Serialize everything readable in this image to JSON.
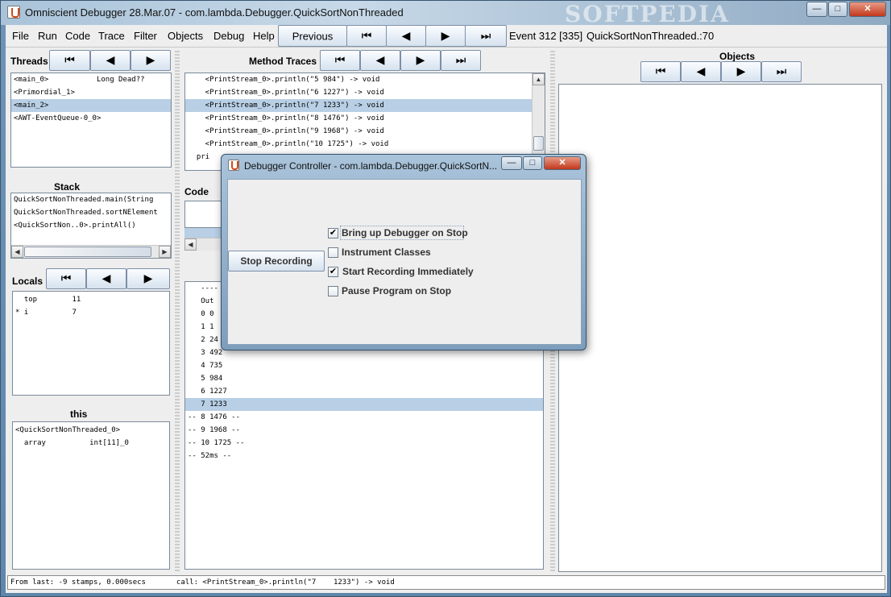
{
  "window": {
    "title": "Omniscient Debugger 28.Mar.07 - com.lambda.Debugger.QuickSortNonThreaded",
    "watermark": "SOFTPEDIA",
    "minimize": "—",
    "maximize": "□",
    "close": "✕"
  },
  "menubar": {
    "items": [
      "File",
      "Run",
      "Code",
      "Trace",
      "Filter",
      "Objects",
      "Debug",
      "Help"
    ],
    "previous_label": "Previous",
    "event_label": "Event 312 [335]",
    "location_label": "QuickSortNonThreaded.:70"
  },
  "nav_glyphs": {
    "first": "⏮",
    "prev": "◀",
    "next": "▶",
    "last": "⏭"
  },
  "threads": {
    "title": "Threads",
    "rows": [
      {
        "text": "<main_0>           Long Dead??",
        "selected": false
      },
      {
        "text": "<Primordial_1>",
        "selected": false
      },
      {
        "text": "<main_2>",
        "selected": true
      },
      {
        "text": "<AWT-EventQueue-0_0>",
        "selected": false
      }
    ]
  },
  "stack": {
    "title": "Stack",
    "rows": [
      "QuickSortNonThreaded.main(String",
      "QuickSortNonThreaded.sortNElement",
      "<QuickSortNon..0>.printAll()"
    ]
  },
  "locals": {
    "title": "Locals",
    "rows": [
      "  top        11",
      "* i          7"
    ]
  },
  "this_panel": {
    "title": "this",
    "rows": [
      "<QuickSortNonThreaded_0>",
      "  array          int[11]_0"
    ]
  },
  "method_traces": {
    "title": "Method Traces",
    "rows": [
      {
        "text": "    <PrintStream_0>.println(\"5 984\") -> void",
        "selected": false
      },
      {
        "text": "    <PrintStream_0>.println(\"6 1227\") -> void",
        "selected": false
      },
      {
        "text": "    <PrintStream_0>.println(\"7 1233\") -> void",
        "selected": true
      },
      {
        "text": "    <PrintStream_0>.println(\"8 1476\") -> void",
        "selected": false
      },
      {
        "text": "    <PrintStream_0>.println(\"9 1968\") -> void",
        "selected": false
      },
      {
        "text": "    <PrintStream_0>.println(\"10 1725\") -> void",
        "selected": false
      },
      {
        "text": "  pri",
        "selected": false
      }
    ]
  },
  "code": {
    "title": "Code"
  },
  "output": {
    "rows": [
      {
        "text": "   ----",
        "selected": false
      },
      {
        "text": "   Out",
        "selected": false
      },
      {
        "text": "   0 0",
        "selected": false
      },
      {
        "text": "   1 1",
        "selected": false
      },
      {
        "text": "   2 24",
        "selected": false
      },
      {
        "text": "   3 492",
        "selected": false
      },
      {
        "text": "   4 735",
        "selected": false
      },
      {
        "text": "   5 984",
        "selected": false
      },
      {
        "text": "   6 1227",
        "selected": false
      },
      {
        "text": "   7 1233",
        "selected": true
      },
      {
        "text": "-- 8 1476 --",
        "selected": false
      },
      {
        "text": "-- 9 1968 --",
        "selected": false
      },
      {
        "text": "-- 10 1725 --",
        "selected": false
      },
      {
        "text": "-- 52ms --",
        "selected": false
      }
    ]
  },
  "objects": {
    "title": "Objects"
  },
  "dialog": {
    "title": "Debugger Controller - com.lambda.Debugger.QuickSortN...",
    "stop_button": "Stop Recording",
    "options": [
      {
        "label": "Bring up Debugger on Stop",
        "checked": true,
        "focused": true
      },
      {
        "label": "Instrument Classes",
        "checked": false,
        "focused": false
      },
      {
        "label": "Start Recording Immediately",
        "checked": true,
        "focused": false
      },
      {
        "label": "Pause Program on Stop",
        "checked": false,
        "focused": false
      }
    ],
    "check_glyph": "✔"
  },
  "status": {
    "text": "From last: -9 stamps, 0.000secs       call: <PrintStream_0>.println(\"7    1233\") -> void"
  },
  "colors": {
    "selection": "#b8cfe5",
    "panel_bg": "#eeeeee",
    "accent": "#c2371b"
  }
}
